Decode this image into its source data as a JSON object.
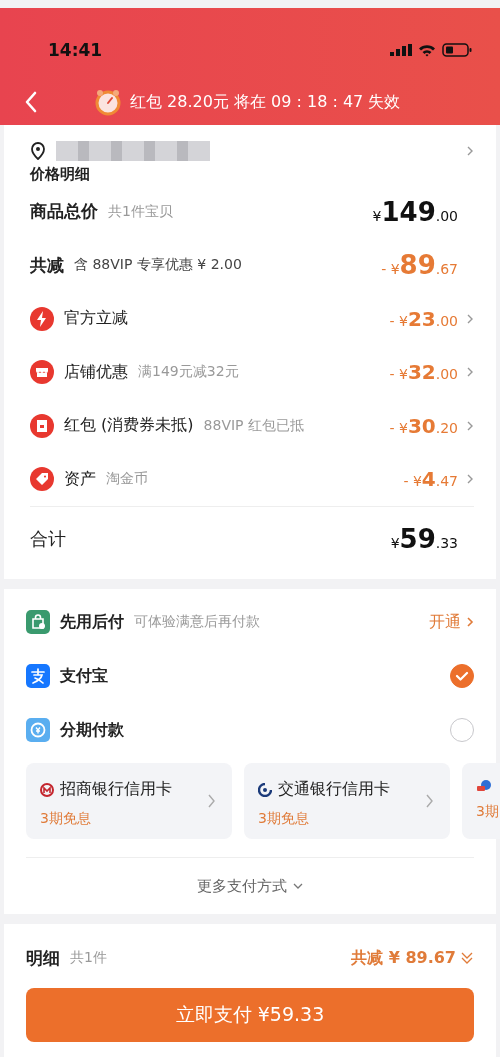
{
  "status_bar": {
    "time": "14:41"
  },
  "header": {
    "notice": "红包 28.20元 将在 09 : 18 : 47 失效"
  },
  "price_details": {
    "title": "价格明细",
    "rows": [
      {
        "kind": "total",
        "label": "商品总价",
        "note": "共1件宝贝",
        "amount": "¥149.00"
      },
      {
        "kind": "discount",
        "label": "共减",
        "note": "含 88VIP 专享优惠 ¥ 2.00",
        "amount": "- ¥89.67"
      },
      {
        "kind": "item",
        "label": "官方立减",
        "amount": "- ¥23.00"
      },
      {
        "kind": "item",
        "label": "店铺优惠",
        "note": "满149元减32元",
        "amount": "- ¥32.00"
      },
      {
        "kind": "item",
        "label": "红包 (消费券未抵)",
        "note": "88VIP 红包已抵",
        "amount": "- ¥30.20"
      },
      {
        "kind": "item",
        "label": "资产",
        "note": "淘金币",
        "amount": "- ¥4.47"
      }
    ],
    "sum": {
      "label": "合计",
      "amount": "¥59.33"
    }
  },
  "payment": {
    "methods": [
      {
        "kind": "link",
        "label": "先用后付",
        "note": "可体验满意后再付款",
        "action": "开通"
      },
      {
        "kind": "radio",
        "label": "支付宝",
        "selected": true
      },
      {
        "kind": "radio",
        "label": "分期付款",
        "selected": false
      }
    ],
    "cards": [
      {
        "title": "招商银行信用卡",
        "subtitle": "3期免息"
      },
      {
        "title": "交通银行信用卡",
        "subtitle": "3期免息"
      },
      {
        "subtitle": "3期"
      }
    ],
    "more": "更多支付方式"
  },
  "footer": {
    "label": "明细",
    "count": "共1件",
    "discount": "共减 ¥ 89.67",
    "pay_button": "立即支付 ¥59.33"
  }
}
